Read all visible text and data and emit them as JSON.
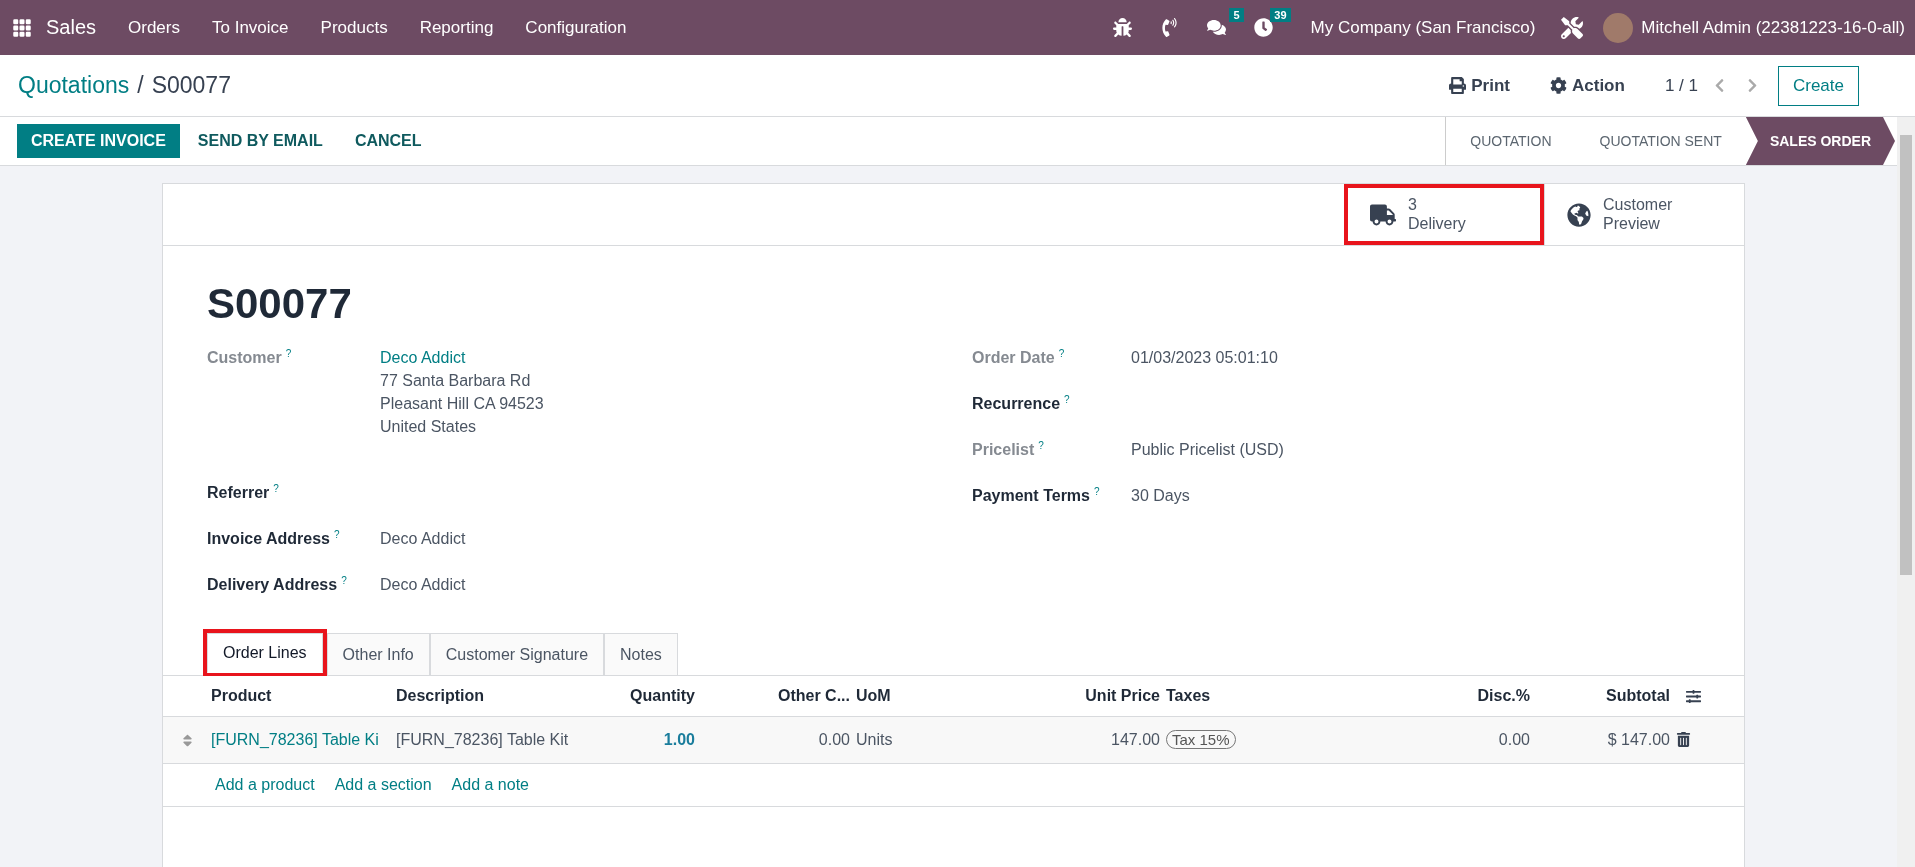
{
  "navbar": {
    "app": "Sales",
    "menu": [
      "Orders",
      "To Invoice",
      "Products",
      "Reporting",
      "Configuration"
    ],
    "systray": [
      {
        "kind": "bug"
      },
      {
        "kind": "phone"
      },
      {
        "kind": "chat",
        "count": "5"
      },
      {
        "kind": "clock",
        "count": "39"
      }
    ],
    "company": "My Company (San Francisco)",
    "user": "Mitchell Admin (22381223-16-0-all)"
  },
  "breadcrumb": {
    "parent": "Quotations",
    "separator": "/",
    "current": "S00077"
  },
  "actions": {
    "print": "Print",
    "action": "Action",
    "pager": "1 / 1",
    "create": "Create"
  },
  "buttons": [
    {
      "label": "CREATE INVOICE",
      "primary": true
    },
    {
      "label": "SEND BY EMAIL",
      "primary": false
    },
    {
      "label": "CANCEL",
      "primary": false
    }
  ],
  "status_bar": [
    {
      "label": "QUOTATION",
      "selected": false
    },
    {
      "label": "QUOTATION SENT",
      "selected": false
    },
    {
      "label": "SALES ORDER",
      "selected": true
    }
  ],
  "smart_buttons": [
    {
      "kind": "truck",
      "value": "3",
      "label": "Delivery",
      "highlighted": true
    },
    {
      "kind": "globe",
      "lines": [
        "Customer",
        "Preview"
      ],
      "highlighted": false
    }
  ],
  "title": "S00077",
  "left_fields": [
    {
      "label": "Customer",
      "help": "?",
      "muted": true,
      "link": "Deco Addict",
      "lines": [
        "77 Santa Barbara Rd",
        "Pleasant Hill CA 94523",
        "United States"
      ]
    },
    {
      "label": "Referrer",
      "help": "?",
      "muted": false
    },
    {
      "label": "Invoice Address",
      "help": "?",
      "muted": false,
      "value": "Deco Addict"
    },
    {
      "label": "Delivery Address",
      "help": "?",
      "muted": false,
      "value": "Deco Addict"
    }
  ],
  "right_fields": [
    {
      "label": "Order Date",
      "help": "?",
      "muted": true,
      "value": "01/03/2023 05:01:10"
    },
    {
      "label": "Recurrence",
      "help": "?",
      "muted": false
    },
    {
      "label": "Pricelist",
      "help": "?",
      "muted": true,
      "value": "Public Pricelist (USD)"
    },
    {
      "label": "Payment Terms",
      "help": "?",
      "muted": false,
      "value": "30 Days"
    }
  ],
  "tabs": [
    {
      "label": "Order Lines",
      "selected": true,
      "highlighted": true
    },
    {
      "label": "Other Info",
      "selected": false,
      "highlighted": false
    },
    {
      "label": "Customer Signature",
      "selected": false,
      "highlighted": false
    },
    {
      "label": "Notes",
      "selected": false,
      "highlighted": false
    }
  ],
  "table": {
    "columns": [
      {
        "label": "Product",
        "kind": "text"
      },
      {
        "label": "Description",
        "kind": "text"
      },
      {
        "label": "Quantity",
        "kind": "number"
      },
      {
        "label": "Other C...",
        "kind": "number"
      },
      {
        "label": "UoM",
        "kind": "text"
      },
      {
        "label": "Unit Price",
        "kind": "number"
      },
      {
        "label": "Taxes",
        "kind": "text"
      },
      {
        "label": "Disc.%",
        "kind": "number"
      },
      {
        "label": "Subtotal",
        "kind": "number"
      }
    ],
    "rows": [
      {
        "cells": [
          {
            "text": "[FURN_78236] Table Ki",
            "kind": "link"
          },
          {
            "text": "[FURN_78236] Table Kit",
            "kind": "text"
          },
          {
            "text": "1.00",
            "kind": "strong"
          },
          {
            "text": "0.00",
            "kind": "text"
          },
          {
            "text": "Units",
            "kind": "text"
          },
          {
            "text": "147.00",
            "kind": "text"
          },
          {
            "text": "Tax 15%",
            "kind": "tag"
          },
          {
            "text": "0.00",
            "kind": "text"
          },
          {
            "text": "$ 147.00",
            "kind": "text"
          }
        ]
      }
    ],
    "add_links": [
      "Add a product",
      "Add a section",
      "Add a note"
    ]
  }
}
